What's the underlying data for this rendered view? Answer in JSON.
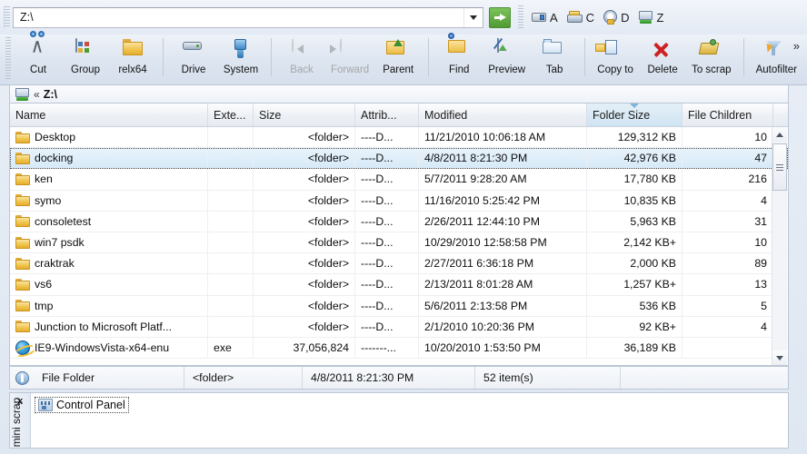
{
  "address": {
    "value": "Z:\\",
    "placeholder": "",
    "go_label": "Go",
    "dropdown_label": "History"
  },
  "drives": [
    {
      "letter": "A",
      "icon": "floppy-drive-icon"
    },
    {
      "letter": "C",
      "icon": "hard-disk-icon"
    },
    {
      "letter": "D",
      "icon": "cd-drive-icon"
    },
    {
      "letter": "Z",
      "icon": "network-drive-icon"
    }
  ],
  "toolbar": {
    "overflow_label": "»",
    "groups": [
      {
        "buttons": [
          {
            "label": "Cut",
            "icon": "scissors-icon",
            "disabled": false
          },
          {
            "label": "Group",
            "icon": "group-icon",
            "disabled": false
          },
          {
            "label": "relx64",
            "icon": "folder-icon",
            "disabled": false
          }
        ]
      },
      {
        "buttons": [
          {
            "label": "Drive",
            "icon": "drive-icon",
            "disabled": false
          },
          {
            "label": "System",
            "icon": "system-icon",
            "disabled": false
          }
        ]
      },
      {
        "buttons": [
          {
            "label": "Back",
            "icon": "back-arrow-icon",
            "disabled": true
          },
          {
            "label": "Forward",
            "icon": "forward-arrow-icon",
            "disabled": true
          },
          {
            "label": "Parent",
            "icon": "parent-folder-icon",
            "disabled": false
          }
        ]
      },
      {
        "buttons": [
          {
            "label": "Find",
            "icon": "find-icon",
            "disabled": false
          },
          {
            "label": "Preview",
            "icon": "preview-icon",
            "disabled": false
          },
          {
            "label": "Tab",
            "icon": "tab-icon",
            "disabled": false
          }
        ]
      },
      {
        "buttons": [
          {
            "label": "Copy to",
            "icon": "copy-to-icon",
            "disabled": false
          },
          {
            "label": "Delete",
            "icon": "delete-x-icon",
            "disabled": false
          },
          {
            "label": "To scrap",
            "icon": "to-scrap-icon",
            "disabled": false
          }
        ]
      },
      {
        "buttons": [
          {
            "label": "Autofilter",
            "icon": "autofilter-icon",
            "disabled": false
          }
        ]
      }
    ]
  },
  "breadcrumb": {
    "separator": "«",
    "path": "Z:\\",
    "icon": "network-drive-icon"
  },
  "list": {
    "columns": [
      {
        "label": "Name",
        "align": "left",
        "sorted": false
      },
      {
        "label": "Exte...",
        "align": "left",
        "sorted": false
      },
      {
        "label": "Size",
        "align": "right",
        "sorted": false
      },
      {
        "label": "Attrib...",
        "align": "left",
        "sorted": false
      },
      {
        "label": "Modified",
        "align": "left",
        "sorted": false
      },
      {
        "label": "Folder Size",
        "align": "right",
        "sorted": true
      },
      {
        "label": "File Children",
        "align": "right",
        "sorted": false
      }
    ],
    "rows": [
      {
        "icon": "folder-icon",
        "name": "Desktop",
        "ext": "",
        "size": "<folder>",
        "attr": "----D...",
        "modified": "11/21/2010 10:06:18 AM",
        "folder_size": "129,312 KB",
        "children": "10",
        "selected": false
      },
      {
        "icon": "folder-icon",
        "name": "docking",
        "ext": "",
        "size": "<folder>",
        "attr": "----D...",
        "modified": "4/8/2011 8:21:30 PM",
        "folder_size": "42,976 KB",
        "children": "47",
        "selected": true
      },
      {
        "icon": "folder-icon",
        "name": "ken",
        "ext": "",
        "size": "<folder>",
        "attr": "----D...",
        "modified": "5/7/2011 9:28:20 AM",
        "folder_size": "17,780 KB",
        "children": "216",
        "selected": false
      },
      {
        "icon": "folder-icon",
        "name": "symo",
        "ext": "",
        "size": "<folder>",
        "attr": "----D...",
        "modified": "11/16/2010 5:25:42 PM",
        "folder_size": "10,835 KB",
        "children": "4",
        "selected": false
      },
      {
        "icon": "folder-icon",
        "name": "consoletest",
        "ext": "",
        "size": "<folder>",
        "attr": "----D...",
        "modified": "2/26/2011 12:44:10 PM",
        "folder_size": "5,963 KB",
        "children": "31",
        "selected": false
      },
      {
        "icon": "folder-icon",
        "name": "win7 psdk",
        "ext": "",
        "size": "<folder>",
        "attr": "----D...",
        "modified": "10/29/2010 12:58:58 PM",
        "folder_size": "2,142 KB+",
        "children": "10",
        "selected": false
      },
      {
        "icon": "folder-icon",
        "name": "craktrak",
        "ext": "",
        "size": "<folder>",
        "attr": "----D...",
        "modified": "2/27/2011 6:36:18 PM",
        "folder_size": "2,000 KB",
        "children": "89",
        "selected": false
      },
      {
        "icon": "folder-icon",
        "name": "vs6",
        "ext": "",
        "size": "<folder>",
        "attr": "----D...",
        "modified": "2/13/2011 8:01:28 AM",
        "folder_size": "1,257 KB+",
        "children": "13",
        "selected": false
      },
      {
        "icon": "folder-icon",
        "name": "tmp",
        "ext": "",
        "size": "<folder>",
        "attr": "----D...",
        "modified": "5/6/2011 2:13:58 PM",
        "folder_size": "536 KB",
        "children": "5",
        "selected": false
      },
      {
        "icon": "folder-icon",
        "name": "Junction to Microsoft Platf...",
        "ext": "",
        "size": "<folder>",
        "attr": "----D...",
        "modified": "2/1/2010 10:20:36 PM",
        "folder_size": "92 KB+",
        "children": "4",
        "selected": false
      },
      {
        "icon": "internet-explorer-icon",
        "name": "IE9-WindowsVista-x64-enu",
        "ext": "exe",
        "size": "37,056,824",
        "attr": "-------...",
        "modified": "10/20/2010 1:53:50 PM",
        "folder_size": "36,189 KB",
        "children": "",
        "selected": false
      }
    ]
  },
  "scrollbar": {
    "up_label": "Scroll up",
    "down_label": "Scroll down"
  },
  "status": {
    "icon": "info-icon",
    "type": "File Folder",
    "size": "<folder>",
    "modified": "4/8/2011 8:21:30 PM",
    "count": "52 item(s)"
  },
  "scrap": {
    "title": "mini scrap",
    "close_label": "x",
    "items": [
      {
        "icon": "control-panel-icon",
        "label": "Control Panel"
      }
    ]
  },
  "colors": {
    "accent": "#4f9a31",
    "selection": "#d7eaf8",
    "sorted_header": "#cfe4f2",
    "folder": "#ecbe45",
    "delete": "#cc2222"
  }
}
